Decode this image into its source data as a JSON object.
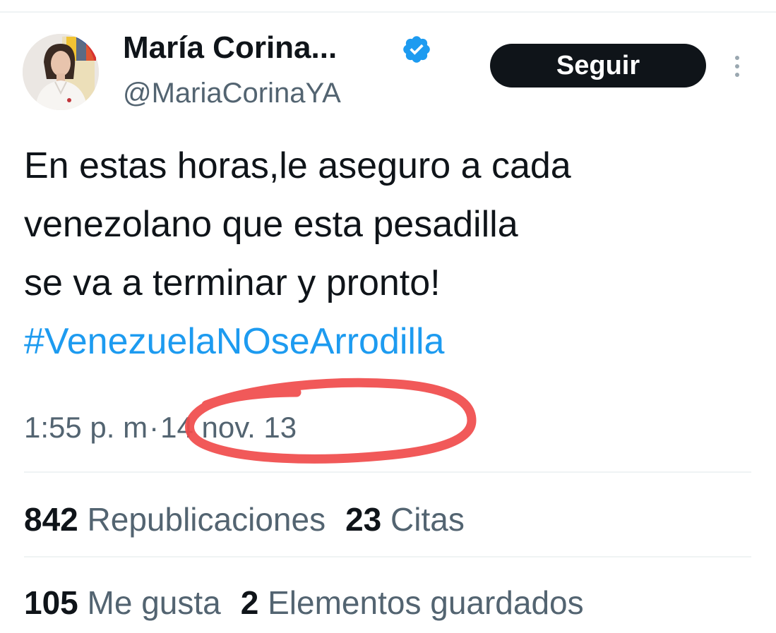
{
  "author": {
    "display_name": "María Corina...",
    "handle": "@MariaCorinaYA"
  },
  "follow_button_label": "Seguir",
  "tweet": {
    "text_lines": [
      "En estas horas,le aseguro a cada",
      "venezolano que esta pesadilla",
      "se va a terminar y pronto!"
    ],
    "hashtag": "#VenezuelaNOseArrodilla",
    "time": "1:55 p. m",
    "separator": "·",
    "date": "14 nov. 13"
  },
  "stats": {
    "reposts_count": "842",
    "reposts_label": "Republicaciones",
    "quotes_count": "23",
    "quotes_label": "Citas",
    "likes_count": "105",
    "likes_label": "Me gusta",
    "bookmarks_count": "2",
    "bookmarks_label": "Elementos guardados"
  },
  "colors": {
    "text": "#0f1419",
    "secondary_text": "#536471",
    "link": "#1d9bf0",
    "verified_badge": "#1d9bf0",
    "follow_button_bg": "#0f1419",
    "annotation_ink": "#f04b4b"
  },
  "icons": {
    "verified": "verified-badge-icon",
    "more": "more-vertical-icon"
  }
}
